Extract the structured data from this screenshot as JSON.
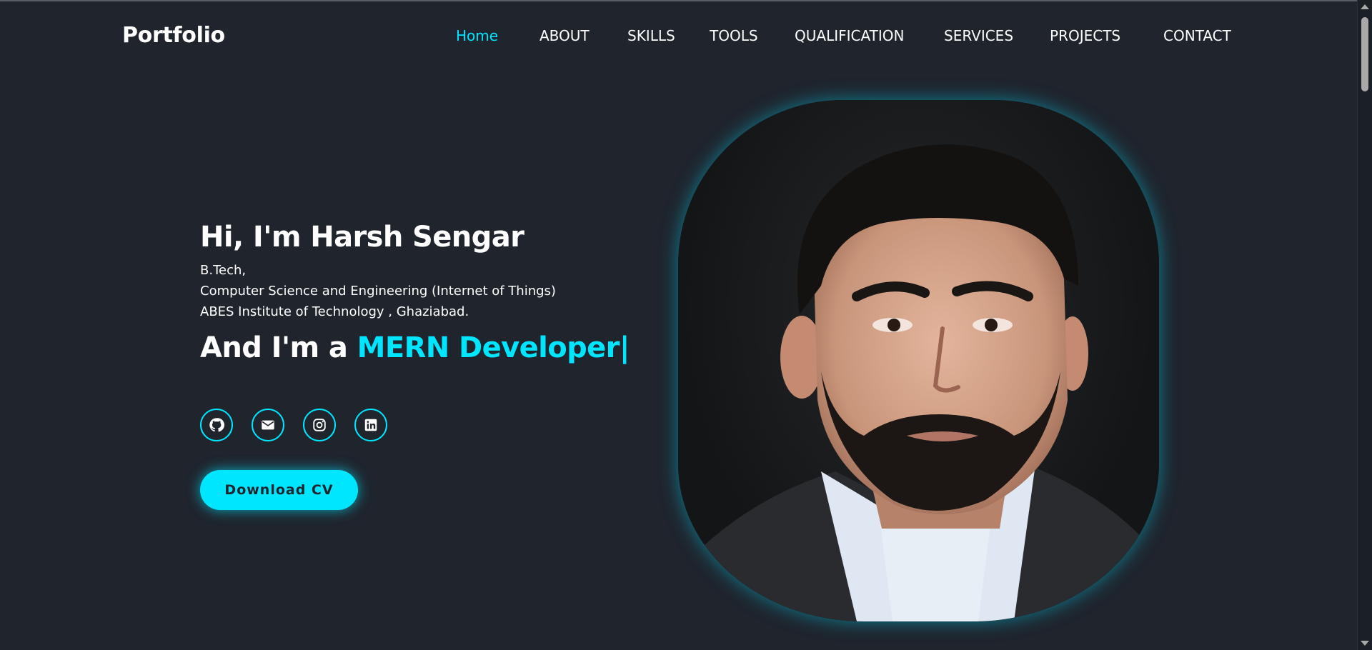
{
  "header": {
    "logo": "Portfolio",
    "nav": [
      {
        "label": "Home",
        "active": true
      },
      {
        "label": "ABOUT"
      },
      {
        "label": "SKILLS"
      },
      {
        "label": "TOOLS"
      },
      {
        "label": "QUALIFICATION"
      },
      {
        "label": "SERVICES"
      },
      {
        "label": "PROJECTS"
      },
      {
        "label": "CONTACT"
      }
    ]
  },
  "hero": {
    "greeting": "Hi, I'm Harsh Sengar",
    "education": [
      "B.Tech,",
      "Computer Science and Engineering (Internet of Things)",
      "ABES Institute of Technology , Ghaziabad."
    ],
    "role_prefix": "And I'm a ",
    "role_highlight": "MERN Developer",
    "caret": "|",
    "socials": [
      {
        "icon": "github-icon"
      },
      {
        "icon": "mail-icon"
      },
      {
        "icon": "instagram-icon"
      },
      {
        "icon": "linkedin-icon"
      }
    ],
    "cv_button": "Download CV"
  },
  "colors": {
    "background": "#1f242d",
    "accent": "#00e6ff",
    "text": "#ffffff"
  }
}
